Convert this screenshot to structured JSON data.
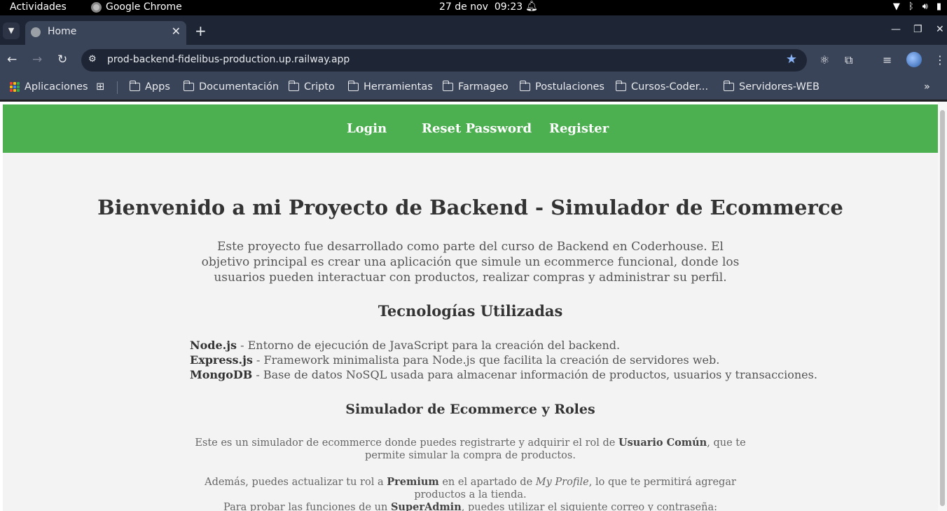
{
  "os": {
    "activities": "Actividades",
    "app_name": "Google Chrome",
    "date": "27 de nov",
    "time": "09:23"
  },
  "browser": {
    "tab_title": "Home",
    "url": "prod-backend-fidelibus-production.up.railway.app",
    "bookmarks": [
      "Aplicaciones",
      "Apps",
      "Documentación",
      "Cripto",
      "Herramientas",
      "Farmageo",
      "Postulaciones",
      "Cursos-Coder...",
      "Servidores-WEB"
    ]
  },
  "nav": {
    "login": "Login",
    "reset": "Reset Password",
    "register": "Register"
  },
  "content": {
    "title": "Bienvenido a mi Proyecto de Backend - Simulador de Ecommerce",
    "intro": "Este proyecto fue desarrollado como parte del curso de Backend en Coderhouse. El objetivo principal es crear una aplicación que simule un ecommerce funcional, donde los usuarios pueden interactuar con productos, realizar compras y administrar su perfil.",
    "tech_heading": "Tecnologías Utilizadas",
    "techs": [
      {
        "name": "Node.js",
        "desc": " - Entorno de ejecución de JavaScript para la creación del backend."
      },
      {
        "name": "Express.js",
        "desc": " - Framework minimalista para Node.js que facilita la creación de servidores web."
      },
      {
        "name": "MongoDB",
        "desc": " - Base de datos NoSQL usada para almacenar información de productos, usuarios y transacciones."
      }
    ],
    "sim_heading": "Simulador de Ecommerce y Roles",
    "p1_a": "Este es un simulador de ecommerce donde puedes registrarte y adquirir el rol de ",
    "p1_b": "Usuario Común",
    "p1_c": ", que te permite simular la compra de productos.",
    "p2_a": "Además, puedes actualizar tu rol a ",
    "p2_b": "Premium",
    "p2_c": " en el apartado de ",
    "p2_d": "My Profile",
    "p2_e": ", lo que te permitirá agregar productos a la tienda.",
    "p3_a": "Para probar las funciones de un ",
    "p3_b": "SuperAdmin",
    "p3_c": ", puedes utilizar el siguiente correo y contraseña:"
  }
}
